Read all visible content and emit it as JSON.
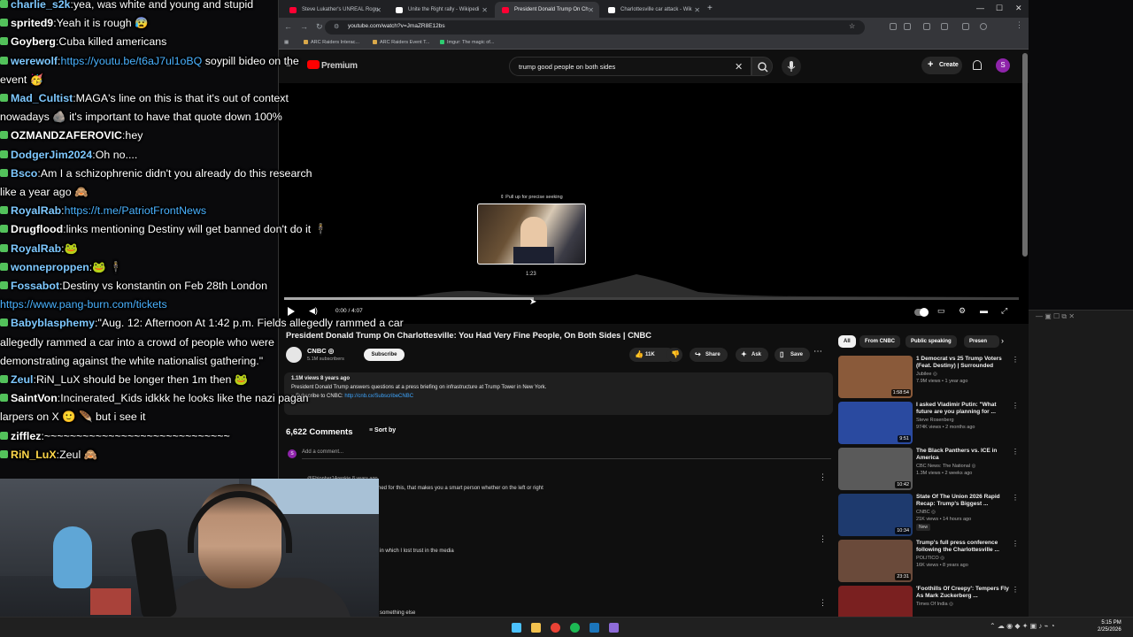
{
  "browser": {
    "tabs": [
      {
        "label": "Steve Lukather's UNREAL Rogu",
        "color": "#ff0033"
      },
      {
        "label": "Unite the Right rally - Wikipedi",
        "color": "#ffffff"
      },
      {
        "label": "President Donald Trump On Ch",
        "color": "#ff0033"
      },
      {
        "label": "Charlottesville car attack - Wik",
        "color": "#ffffff"
      }
    ],
    "new_tab": "+",
    "url": "youtube.com/watch?v=JmaZR8E12bs",
    "bookmarks": [
      "ARC Raiders Interac...",
      "ARC Raiders Event T...",
      "Imgur: The magic of..."
    ]
  },
  "youtube": {
    "logo": "Premium",
    "search_query": "trump good people on both sides",
    "create_label": "Create",
    "avatar_letter": "S",
    "player": {
      "seek_hint": "⇕ Pull up for precise seeking",
      "preview_time": "1:23",
      "time": "0:00 / 4:07",
      "progress_fraction": 0.34
    },
    "video_title": "President Donald Trump On Charlottesville: You Had Very Fine People, On Both Sides | CNBC",
    "channel": {
      "name": "CNBC ◎",
      "subs": "5.1M subscribers",
      "subscribe": "Subscribe"
    },
    "actions": {
      "likes": "11K",
      "share": "Share",
      "ask": "Ask",
      "save": "Save"
    },
    "description": {
      "meta": "1.1M views  8 years ago",
      "text": "President Donald Trump answers questions at a press briefing on infrastructure at Trump Tower in New York.",
      "subscribe_prefix": "» Subscribe to CNBC: ",
      "subscribe_link": "http://cnb.cx/SubscribeCNBC"
    },
    "comments": {
      "count": "6,622 Comments",
      "sort": "Sort by",
      "placeholder": "Add a comment...",
      "items": [
        {
          "author": "@Ehiopher1Arenkie  8 years ago",
          "text": "ned for this, that makes you a smart person whether on the left or right"
        },
        {
          "author": "",
          "text": "in which I lost trust in the media"
        },
        {
          "author": "",
          "text": "something else"
        }
      ]
    },
    "chips": [
      "All",
      "From CNBC",
      "Public speaking",
      "Presen"
    ],
    "recommended": [
      {
        "title": "1 Democrat vs 25 Trump Voters (Feat. Destiny) | Surrounded",
        "channel": "Jubilee ◎",
        "meta": "7.9M views • 1 year ago",
        "duration": "1:58:54",
        "thumb": "#8a5a3a",
        "badge": ""
      },
      {
        "title": "I asked Vladimir Putin: \"What future are you planning for ...",
        "channel": "Steve Rosenberg",
        "meta": "974K views • 2 months ago",
        "duration": "9:51",
        "thumb": "#2a4aa0",
        "badge": ""
      },
      {
        "title": "The Black Panthers vs. ICE in America",
        "channel": "CBC News: The National ◎",
        "meta": "1.3M views • 2 weeks ago",
        "duration": "10:42",
        "thumb": "#5a5a5a",
        "badge": ""
      },
      {
        "title": "State Of The Union 2026 Rapid Recap: Trump's Biggest ...",
        "channel": "CNBC ◎",
        "meta": "21K views • 14 hours ago",
        "duration": "10:34",
        "thumb": "#1e3a6e",
        "badge": "New"
      },
      {
        "title": "Trump's full press conference following the Charlottesville ...",
        "channel": "POLITICO ◎",
        "meta": "16K views • 8 years ago",
        "duration": "23:31",
        "thumb": "#6a4a3a",
        "badge": ""
      },
      {
        "title": "'Foothills Of Creepy': Tempers Fly As Mark Zuckerberg ...",
        "channel": "Times Of India ◎",
        "meta": "",
        "duration": "",
        "thumb": "#7a2020",
        "badge": ""
      }
    ]
  },
  "chat": [
    {
      "user": "charlie_s2k",
      "color": "#7ec8ff",
      "text": "yea, was white and young and stupid"
    },
    {
      "user": "sprited9",
      "color": "#ffffff",
      "text": "Yeah it is rough 😰"
    },
    {
      "user": "Goyberg",
      "color": "#ffffff",
      "text": "Cuba killed americans"
    },
    {
      "user": "werewolf",
      "color": "#7ec8ff",
      "text": "",
      "link": "https://youtu.be/t6aJ7ul1oBQ",
      "after": " soypill bideo on the"
    },
    {
      "user": "",
      "color": "#ffffff",
      "text": "event 🥳"
    },
    {
      "user": "Mad_Cultist",
      "color": "#7ec8ff",
      "text": "MAGA's line on this is that it's out of context"
    },
    {
      "user": "",
      "color": "#ffffff",
      "text": "nowadays 🪨 it's important to have that quote down 100%"
    },
    {
      "user": "OZMANDZAFEROVIC",
      "color": "#ffffff",
      "text": "hey"
    },
    {
      "user": "DodgerJim2024",
      "color": "#7ec8ff",
      "text": "Oh no...."
    },
    {
      "user": "Bsco",
      "color": "#7ec8ff",
      "text": "Am I a schizophrenic didn't you already do this research"
    },
    {
      "user": "",
      "color": "#ffffff",
      "text": "like a year ago 🙈"
    },
    {
      "user": "RoyalRab",
      "color": "#7ec8ff",
      "text": "",
      "link": "https://t.me/PatriotFrontNews",
      "after": ""
    },
    {
      "user": "Drugflood",
      "color": "#ffffff",
      "text": "links mentioning Destiny will get banned don't do it 🕴"
    },
    {
      "user": "RoyalRab",
      "color": "#7ec8ff",
      "text": "🐸"
    },
    {
      "user": "wonneproppen",
      "color": "#7ec8ff",
      "text": "🐸 🕴"
    },
    {
      "user": "Fossabot",
      "color": "#7ec8ff",
      "text": "Destiny vs konstantin on Feb 28th London"
    },
    {
      "user": "",
      "color": "#ffffff",
      "text": "",
      "link": "https://www.pang-burn.com/tickets",
      "after": ""
    },
    {
      "user": "Babyblasphemy",
      "color": "#7ec8ff",
      "text": "\"Aug. 12: Afternoon At 1:42 p.m. Fields allegedly rammed a car"
    },
    {
      "user": "",
      "color": "#ffffff",
      "text": "allegedly rammed a car into a crowd of people who were"
    },
    {
      "user": "",
      "color": "#ffffff",
      "text": "demonstrating against the white nationalist gathering.\""
    },
    {
      "user": "Zeul",
      "color": "#7ec8ff",
      "text": "RiN_LuX should be longer then 1m then 🐸"
    },
    {
      "user": "SaintVon",
      "color": "#ffffff",
      "text": "Incinerated_Kids idkkk he looks like the nazi pagan"
    },
    {
      "user": "",
      "color": "#ffffff",
      "text": "larpers on X 🙂 🪶 but i see it"
    },
    {
      "user": "zifflez",
      "color": "#ffffff",
      "text": "~~~~~~~~~~~~~~~~~~~~~~~~~~~~~"
    },
    {
      "user": "RiN_LuX",
      "color": "#ffd84a",
      "text": "Zeul 🙈"
    }
  ],
  "taskbar": {
    "time": "5:15 PM",
    "date": "2/25/2026"
  }
}
